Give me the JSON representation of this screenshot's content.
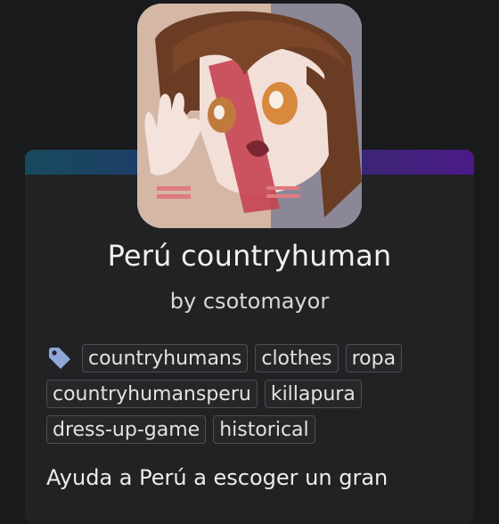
{
  "game": {
    "title": "Perú countryhuman",
    "byline": "by csotomayor",
    "description": "Ayuda a Perú a escoger un gran"
  },
  "tags": [
    {
      "label": "countryhumans"
    },
    {
      "label": "clothes"
    },
    {
      "label": "ropa"
    },
    {
      "label": "countryhumansperu"
    },
    {
      "label": "killapura"
    },
    {
      "label": "dress-up-game"
    },
    {
      "label": "historical"
    }
  ],
  "colors": {
    "background": "#191a1b",
    "card": "#212224",
    "accent_left": "#174a5c",
    "accent_right": "#4a1a88",
    "tag_icon": "#8fa6d9"
  },
  "icons": {
    "tag_icon": "tag-icon"
  }
}
